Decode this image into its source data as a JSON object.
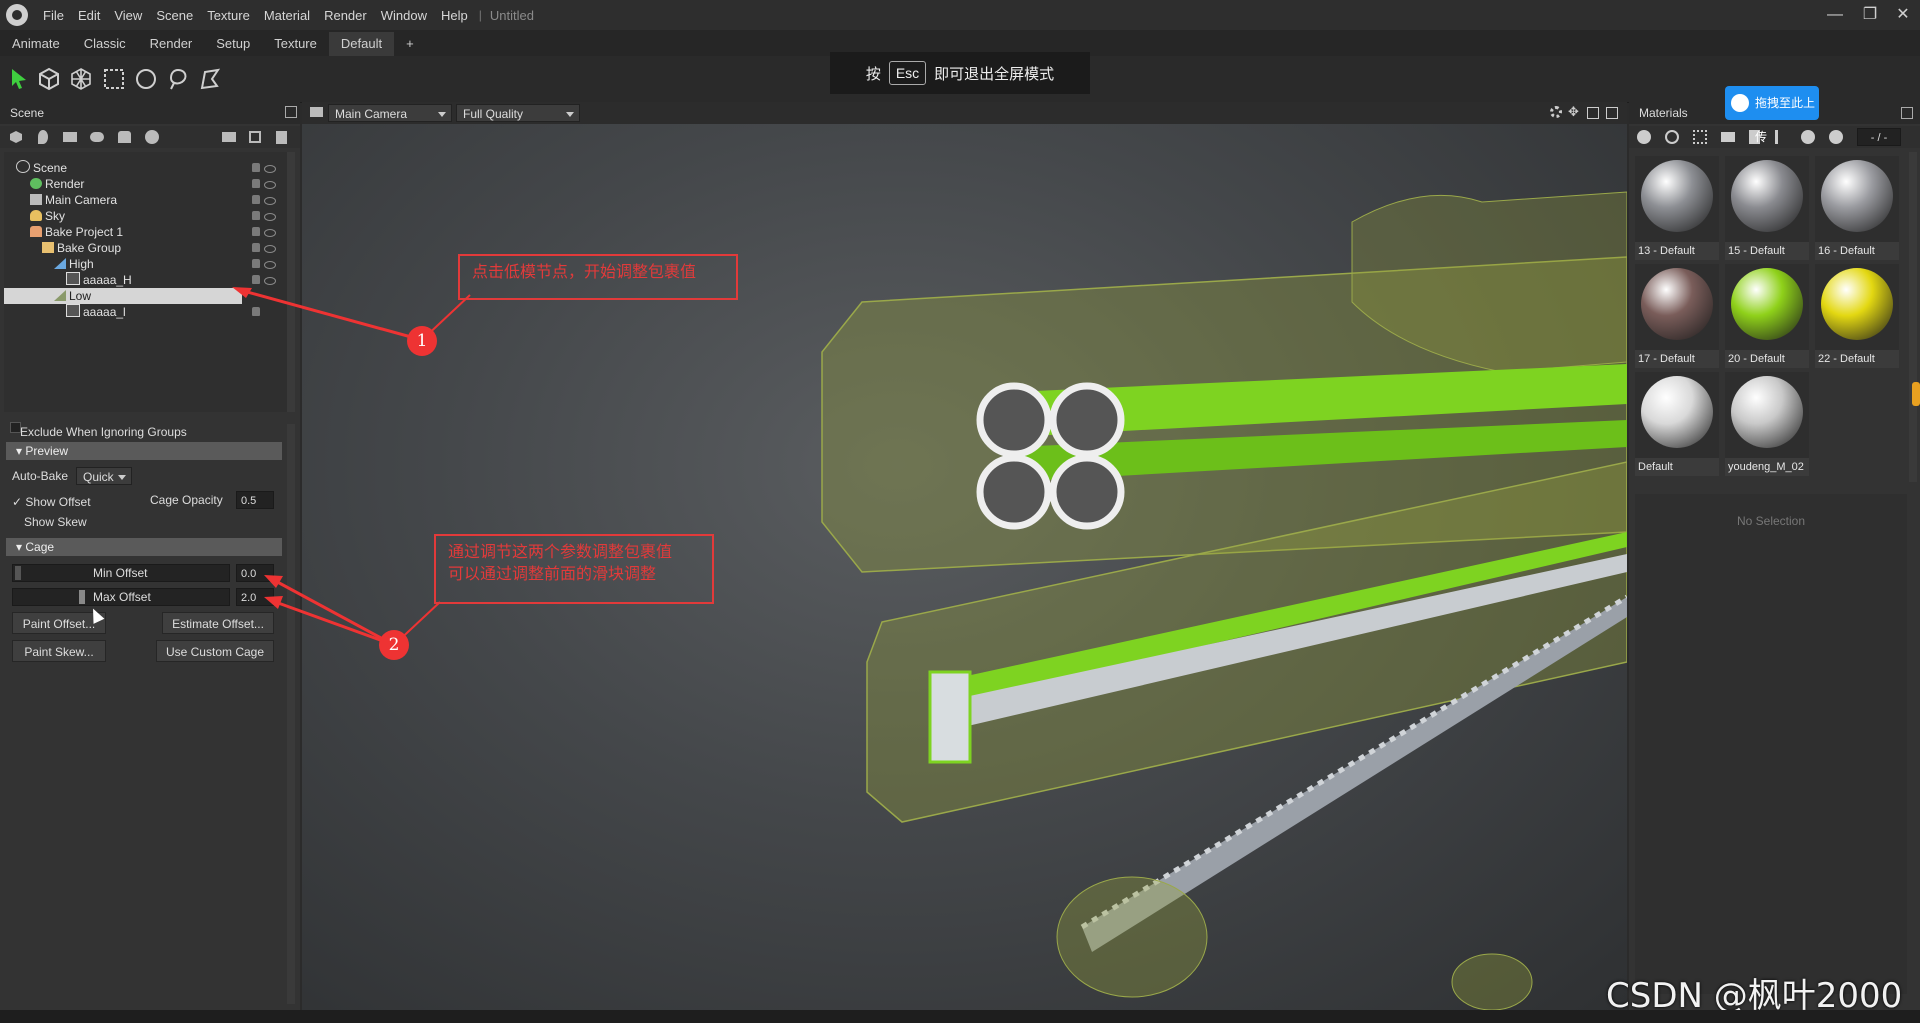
{
  "menu": {
    "items": [
      "File",
      "Edit",
      "View",
      "Scene",
      "Texture",
      "Material",
      "Render",
      "Window",
      "Help"
    ],
    "title": "Untitled"
  },
  "tabs": [
    "Animate",
    "Classic",
    "Render",
    "Setup",
    "Texture",
    "Default",
    "+"
  ],
  "active_tab": "Default",
  "esc_toast": {
    "prefix": "按",
    "key": "Esc",
    "suffix": "即可退出全屏模式"
  },
  "scene": {
    "title": "Scene",
    "tree": [
      {
        "label": "Scene",
        "icon": "scene-icon",
        "depth": 0
      },
      {
        "label": "Render",
        "icon": "render-icon",
        "depth": 1
      },
      {
        "label": "Main Camera",
        "icon": "camera-icon",
        "depth": 1
      },
      {
        "label": "Sky",
        "icon": "sky-icon",
        "depth": 1
      },
      {
        "label": "Bake Project 1",
        "icon": "bake-project-icon",
        "depth": 1
      },
      {
        "label": "Bake Group",
        "icon": "folder-icon",
        "depth": 2
      },
      {
        "label": "High",
        "icon": "mesh-icon",
        "depth": 3
      },
      {
        "label": "aaaaa_H",
        "icon": "object-icon",
        "depth": 4
      },
      {
        "label": "Low",
        "icon": "mesh-icon",
        "depth": 3,
        "selected": true
      },
      {
        "label": "aaaaa_l",
        "icon": "object-icon",
        "depth": 4
      }
    ]
  },
  "props": {
    "exclude_label": "Exclude When Ignoring Groups",
    "preview_title": "Preview",
    "auto_bake_label": "Auto-Bake",
    "auto_bake_value": "Quick",
    "show_offset_label": "Show Offset",
    "show_offset_checked": true,
    "cage_opacity_label": "Cage Opacity",
    "cage_opacity_value": "0.5",
    "show_skew_label": "Show Skew",
    "cage_title": "Cage",
    "min_offset_label": "Min Offset",
    "min_offset_value": "0.0",
    "max_offset_label": "Max Offset",
    "max_offset_value": "2.0",
    "paint_offset_btn": "Paint Offset...",
    "estimate_offset_btn": "Estimate Offset...",
    "paint_skew_btn": "Paint Skew...",
    "custom_cage_btn": "Use Custom Cage"
  },
  "viewport": {
    "camera": "Main Camera",
    "quality": "Full Quality"
  },
  "materials": {
    "title": "Materials",
    "upload_label": "拖拽至此上传",
    "page_label": "- / -",
    "no_selection": "No Selection",
    "items": [
      {
        "name": "13 - Default",
        "color": "#8d8f94"
      },
      {
        "name": "15 - Default",
        "color": "#8a8b90"
      },
      {
        "name": "16 - Default",
        "color": "#9a9ba0"
      },
      {
        "name": "17 - Default",
        "color": "#7a5d5a"
      },
      {
        "name": "20 - Default",
        "color": "#8fd11a"
      },
      {
        "name": "22 - Default",
        "color": "#e3d812"
      },
      {
        "name": "Default",
        "color": "#d9d9d9"
      },
      {
        "name": "youdeng_M_02",
        "color": "#c9c9c9"
      }
    ]
  },
  "annotations": {
    "note1": "点击低模节点，开始调整包裹值",
    "note2_line1": "通过调节这两个参数调整包裹值",
    "note2_line2": "可以通过调整前面的滑块调整",
    "badge1": "1",
    "badge2": "2"
  },
  "watermark": "CSDN @枫叶2000"
}
